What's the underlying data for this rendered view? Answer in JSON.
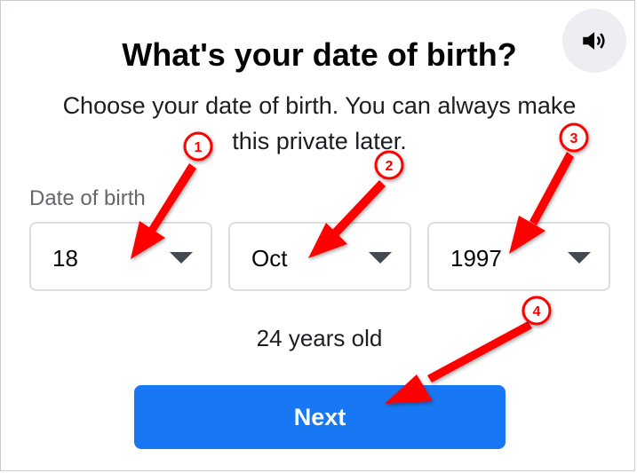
{
  "dialog": {
    "title": "What's your date of birth?",
    "subtitle_line1": "Choose your date of birth. You can always make",
    "subtitle_line2": "this private later.",
    "field_label": "Date of birth",
    "day": {
      "value": "18"
    },
    "month": {
      "value": "Oct"
    },
    "year": {
      "value": "1997"
    },
    "age_text": "24 years old",
    "next_label": "Next",
    "sound_icon": "speaker-volume-icon"
  },
  "annotations": {
    "color": "#ff0000",
    "badges": [
      "1",
      "2",
      "3",
      "4"
    ]
  },
  "colors": {
    "primary_button": "#1877f2",
    "field_border": "#dadde1",
    "annotation_red": "#ff0000"
  }
}
